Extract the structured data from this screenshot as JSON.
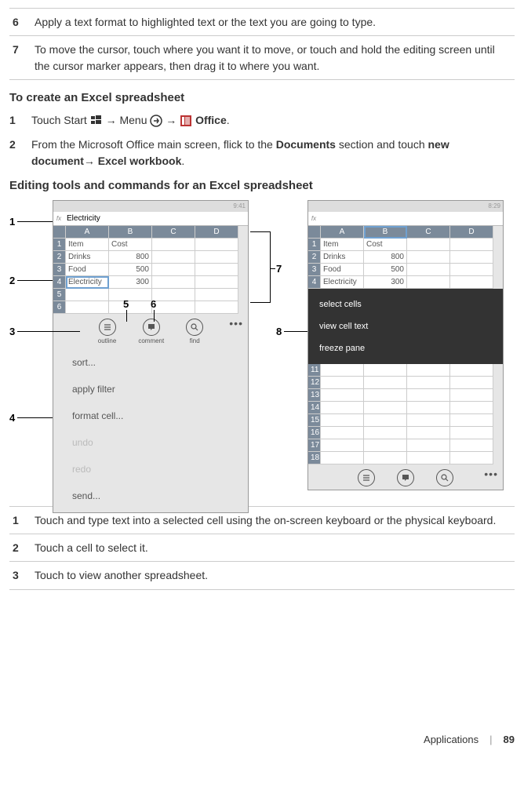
{
  "top_table": [
    {
      "num": "6",
      "text": "Apply a text format to highlighted text or the text you are going to type."
    },
    {
      "num": "7",
      "text": "To move the cursor, touch where you want it to move, or touch and hold the editing screen until the cursor marker appears, then drag it to where you want."
    }
  ],
  "heading1": "To create an Excel spreadsheet",
  "steps": [
    {
      "num": "1",
      "pre": "Touch Start ",
      "mid1": "→ Menu ",
      "mid2": "→ ",
      "bold_last": "Office",
      "tail": "."
    },
    {
      "num": "2",
      "text1": "From the Microsoft Office main screen, flick to the ",
      "bold1": "Documents",
      "text2": " section and touch ",
      "bold2": "new document→ Excel workbook",
      "text3": "."
    }
  ],
  "heading2": "Editing tools and commands for an Excel spreadsheet",
  "phone_left": {
    "time": "9:41",
    "fx_value": "Electricity",
    "cols": [
      "A",
      "B",
      "C",
      "D"
    ],
    "rows": [
      [
        "1",
        "Item",
        "Cost",
        "",
        ""
      ],
      [
        "2",
        "Drinks",
        "800",
        "",
        ""
      ],
      [
        "3",
        "Food",
        "500",
        "",
        ""
      ],
      [
        "4",
        "Electricity",
        "300",
        "",
        ""
      ],
      [
        "5",
        "",
        "",
        "",
        ""
      ],
      [
        "6",
        "",
        "",
        "",
        ""
      ]
    ],
    "appbar": {
      "outline": "outline",
      "comment": "comment",
      "find": "find"
    },
    "menu": [
      "sort...",
      "apply filter",
      "format cell...",
      "undo",
      "redo",
      "send..."
    ]
  },
  "phone_right": {
    "time": "8:29",
    "cols": [
      "A",
      "B",
      "C",
      "D"
    ],
    "rows_top": [
      [
        "1",
        "Item",
        "Cost",
        "",
        ""
      ],
      [
        "2",
        "Drinks",
        "800",
        "",
        ""
      ],
      [
        "3",
        "Food",
        "500",
        "",
        ""
      ],
      [
        "4",
        "Electricity",
        "300",
        "",
        ""
      ]
    ],
    "ctx": [
      "select cells",
      "view cell text",
      "freeze pane"
    ],
    "rows_bottom": [
      "11",
      "12",
      "13",
      "14",
      "15",
      "16",
      "17",
      "18"
    ]
  },
  "callouts": {
    "c1": "1",
    "c2": "2",
    "c3": "3",
    "c4": "4",
    "c5": "5",
    "c6": "6",
    "c7": "7",
    "c8": "8"
  },
  "bottom_table": [
    {
      "num": "1",
      "text": "Touch and type text into a selected cell using the on-screen keyboard or the physical keyboard."
    },
    {
      "num": "2",
      "text": "Touch a cell to select it."
    },
    {
      "num": "3",
      "text": "Touch to view another spreadsheet."
    }
  ],
  "footer": {
    "section": "Applications",
    "page": "89"
  }
}
